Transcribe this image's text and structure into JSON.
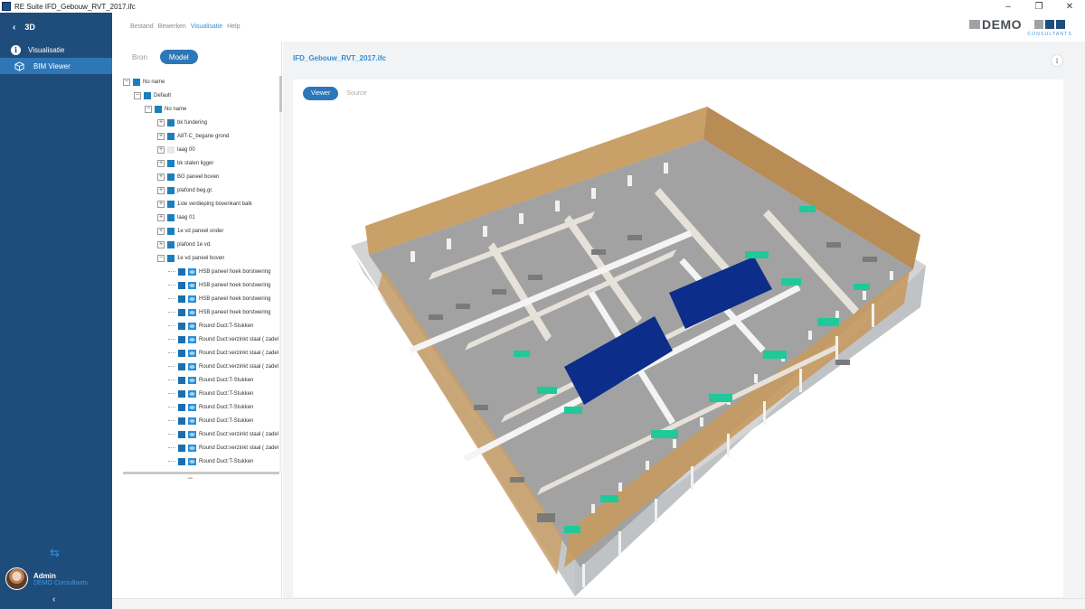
{
  "window": {
    "title": "RE Suite  IFD_Gebouw_RVT_2017.ifc",
    "minimize": "–",
    "restore": "❐",
    "close": "✕"
  },
  "nav": {
    "back_chevron": "‹",
    "back_label": "3D",
    "section_label": "Visualisatie",
    "items": [
      {
        "label": "BIM Viewer"
      }
    ],
    "swap_glyph": "⇆",
    "user_name": "Admin",
    "user_org": "DEMO Consultants",
    "collapse_chevron": "‹"
  },
  "menu": {
    "items": [
      {
        "label": "Bestand"
      },
      {
        "label": "Bewerken"
      },
      {
        "label": "Visualisatie"
      },
      {
        "label": "Help"
      }
    ]
  },
  "logo": {
    "word": "DEMO",
    "sub": "CONSULTANTS"
  },
  "tree_panel": {
    "toggle": {
      "left": "Bron",
      "right": "Model"
    },
    "nodes": [
      {
        "label": "No name",
        "level": 0,
        "toggle": "−",
        "icon": "sq"
      },
      {
        "label": "Default",
        "level": 1,
        "toggle": "−",
        "icon": "sq"
      },
      {
        "label": "No name",
        "level": 2,
        "toggle": "−",
        "icon": "sq"
      },
      {
        "label": "bk fundering",
        "level": 3,
        "toggle": "+",
        "icon": "sq"
      },
      {
        "label": "A8T-C_begane grond",
        "level": 3,
        "toggle": "+",
        "icon": "sq"
      },
      {
        "label": "laag 00",
        "level": 3,
        "toggle": "+",
        "icon": "light"
      },
      {
        "label": "bk stalen ligger",
        "level": 3,
        "toggle": "+",
        "icon": "sq"
      },
      {
        "label": "BG paneel boven",
        "level": 3,
        "toggle": "+",
        "icon": "sq"
      },
      {
        "label": "plafond beg.gr.",
        "level": 3,
        "toggle": "+",
        "icon": "sq"
      },
      {
        "label": "1ste verdieping bovenkant balk",
        "level": 3,
        "toggle": "+",
        "icon": "sq"
      },
      {
        "label": "laag 01",
        "level": 3,
        "toggle": "+",
        "icon": "sq"
      },
      {
        "label": "1e vd paneel onder",
        "level": 3,
        "toggle": "+",
        "icon": "sq"
      },
      {
        "label": "plafond 1e vd.",
        "level": 3,
        "toggle": "+",
        "icon": "sq"
      },
      {
        "label": "1e vd paneel boven",
        "level": 3,
        "toggle": "−",
        "icon": "sq"
      },
      {
        "label": "HSB paneel hoek borstwering",
        "level": 4,
        "toggle": "",
        "icon": "duct"
      },
      {
        "label": "HSB paneel hoek borstwering",
        "level": 4,
        "toggle": "",
        "icon": "duct"
      },
      {
        "label": "HSB paneel hoek borstwering",
        "level": 4,
        "toggle": "",
        "icon": "duct"
      },
      {
        "label": "HSB paneel hoek borstwering",
        "level": 4,
        "toggle": "",
        "icon": "duct"
      },
      {
        "label": "Round Duct:T-Stukken",
        "level": 4,
        "toggle": "",
        "icon": "duct"
      },
      {
        "label": "Round Duct:verzinkt staal ( zadel t",
        "level": 4,
        "toggle": "",
        "icon": "duct"
      },
      {
        "label": "Round Duct:verzinkt staal ( zadel t",
        "level": 4,
        "toggle": "",
        "icon": "duct"
      },
      {
        "label": "Round Duct:verzinkt staal ( zadel t",
        "level": 4,
        "toggle": "",
        "icon": "duct"
      },
      {
        "label": "Round Duct:T-Stukken",
        "level": 4,
        "toggle": "",
        "icon": "duct"
      },
      {
        "label": "Round Duct:T-Stukken",
        "level": 4,
        "toggle": "",
        "icon": "duct"
      },
      {
        "label": "Round Duct:T-Stukken",
        "level": 4,
        "toggle": "",
        "icon": "duct"
      },
      {
        "label": "Round Duct:T-Stukken",
        "level": 4,
        "toggle": "",
        "icon": "duct"
      },
      {
        "label": "Round Duct:verzinkt staal ( zadel t",
        "level": 4,
        "toggle": "",
        "icon": "duct"
      },
      {
        "label": "Round Duct:verzinkt staal ( zadel t",
        "level": 4,
        "toggle": "",
        "icon": "duct"
      },
      {
        "label": "Round Duct:T-Stukken",
        "level": 4,
        "toggle": "",
        "icon": "duct"
      }
    ]
  },
  "main": {
    "file_title": "IFD_Gebouw_RVT_2017.ifc",
    "info_glyph": "i",
    "tabs": [
      {
        "label": "Viewer"
      },
      {
        "label": "Source"
      }
    ]
  },
  "colors": {
    "nav_bg": "#1f4d7b",
    "nav_active": "#2d77b9",
    "accent": "#2d8fd8",
    "model_wood": "#c9a068",
    "model_floor": "#9a9a9a",
    "model_green": "#1fc99a",
    "model_navy": "#0c2d8a"
  }
}
